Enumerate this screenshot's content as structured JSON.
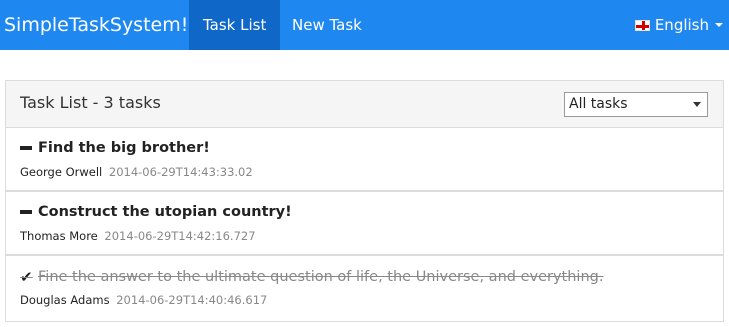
{
  "navbar": {
    "brand": "SimpleTaskSystem!",
    "items": [
      {
        "label": "Task List",
        "active": true
      },
      {
        "label": "New Task",
        "active": false
      }
    ],
    "language": "English",
    "accent": "#1e88f0",
    "active_bg": "#0f67c7"
  },
  "panel": {
    "title": "Task List - 3 tasks",
    "filter_selected": "All tasks"
  },
  "tasks": [
    {
      "title": "Find the big brother!",
      "person": "George Orwell",
      "date": "2014-06-29T14:43:33.02",
      "status_icon": "minus-icon",
      "completed": false
    },
    {
      "title": "Construct the utopian country!",
      "person": "Thomas More",
      "date": "2014-06-29T14:42:16.727",
      "status_icon": "minus-icon",
      "completed": false
    },
    {
      "title": "Fine the answer to the ultimate question of life, the Universe, and everything.",
      "person": "Douglas Adams",
      "date": "2014-06-29T14:40:46.617",
      "status_icon": "check-icon",
      "completed": true
    }
  ]
}
